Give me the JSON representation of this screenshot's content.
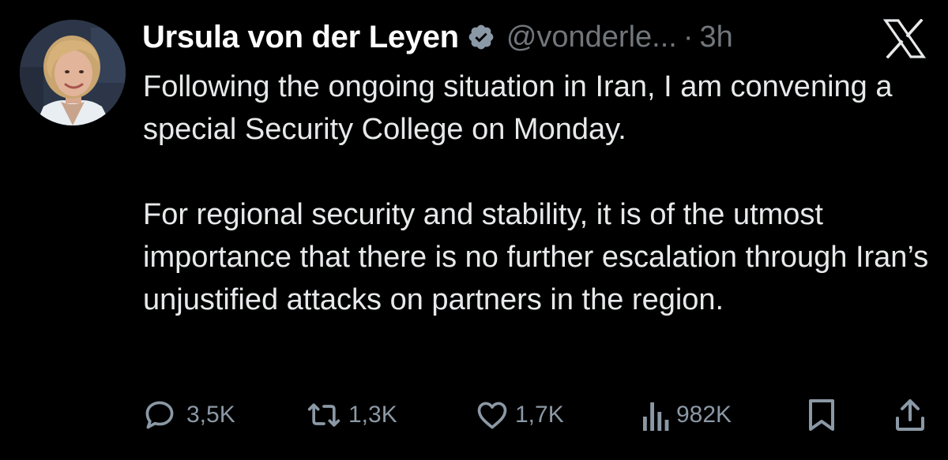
{
  "author": {
    "name": "Ursula von der Leyen",
    "handle": "@vonderle...",
    "separator": "·",
    "time": "3h",
    "avatar_icon": "profile-photo",
    "verified_icon": "verified-badge-icon"
  },
  "tweet": {
    "paragraph1": "Following the ongoing situation in Iran, I am convening a special Security College on Monday.",
    "paragraph2": "For regional security and stability, it is of the utmost importance that there is no further escalation through Iran’s unjustified attacks on partners in the region."
  },
  "actions": {
    "replies": "3,5K",
    "reposts": "1,3K",
    "likes": "1,7K",
    "views": "982K"
  },
  "colors": {
    "background": "#000000",
    "text": "#e7e9ea",
    "muted": "#71767b",
    "verified_badge": "#8b98a5"
  }
}
